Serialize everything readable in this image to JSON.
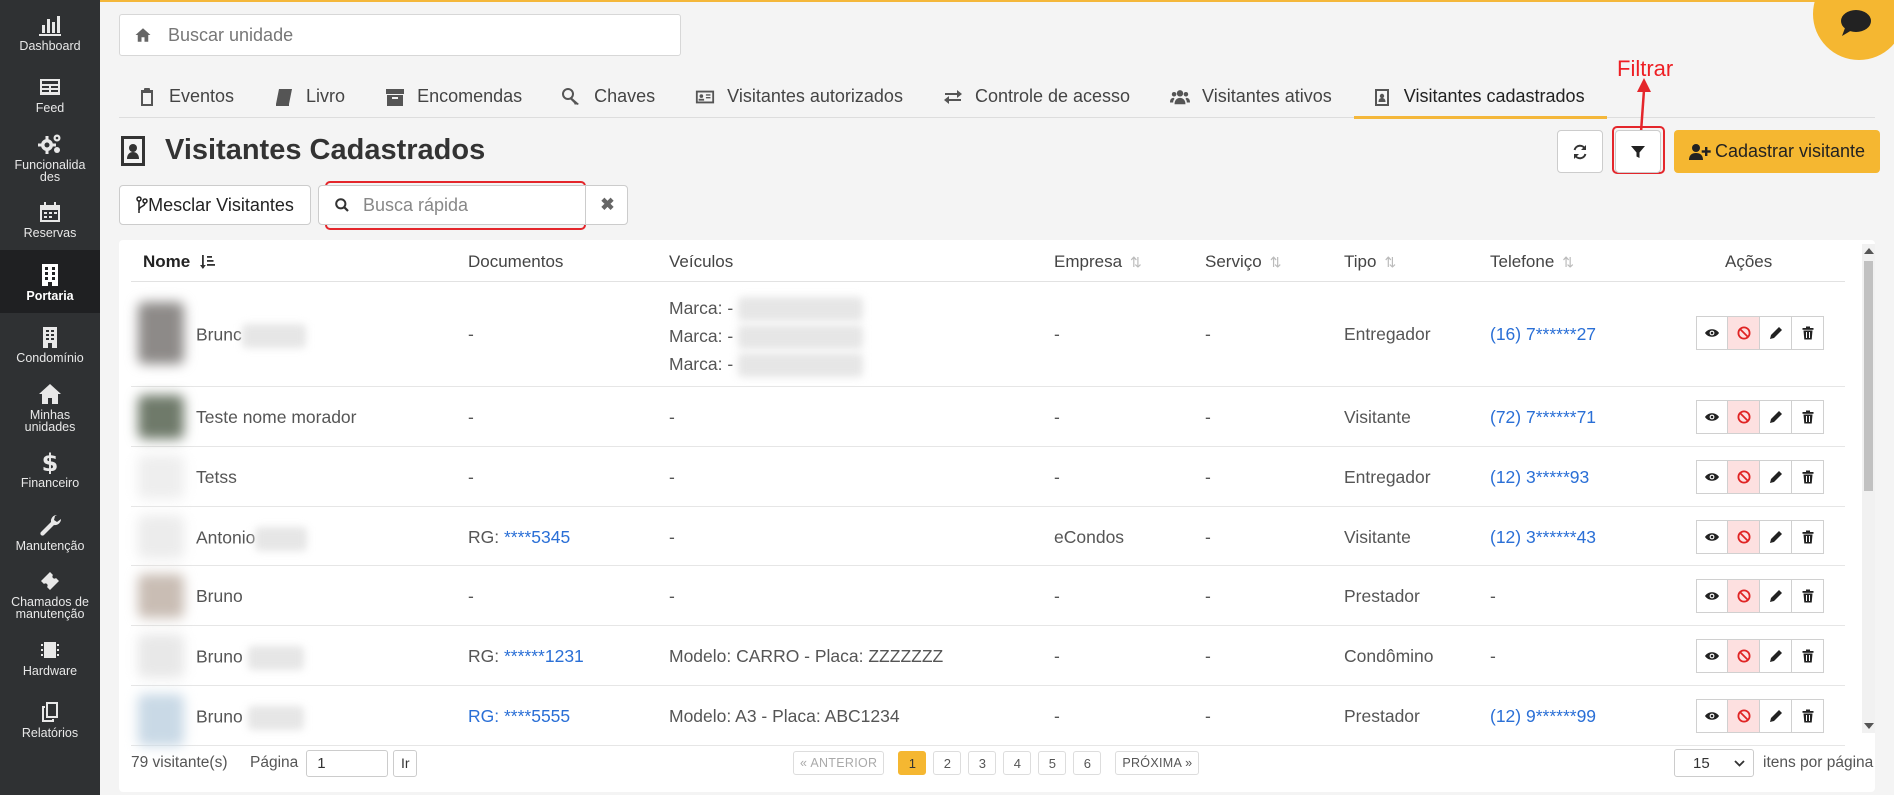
{
  "sidebar": {
    "items": [
      {
        "label": "Dashboard",
        "icon": "bar-chart-icon"
      },
      {
        "label": "Feed",
        "icon": "newspaper-icon"
      },
      {
        "label": "Funcionalidades",
        "icon": "gears-icon"
      },
      {
        "label": "Reservas",
        "icon": "calendar-icon"
      },
      {
        "label": "Portaria",
        "icon": "building-icon",
        "active": true
      },
      {
        "label": "Condomínio",
        "icon": "building-alt-icon"
      },
      {
        "label": "Minhas unidades",
        "icon": "home-icon"
      },
      {
        "label": "Financeiro",
        "icon": "dollar-icon"
      },
      {
        "label": "Manutenção",
        "icon": "wrench-icon"
      },
      {
        "label": "Chamados de manutenção",
        "icon": "ticket-icon"
      },
      {
        "label": "Hardware",
        "icon": "chip-icon"
      },
      {
        "label": "Relatórios",
        "icon": "copy-icon"
      }
    ]
  },
  "unit_search": {
    "placeholder": "Buscar unidade"
  },
  "tabs": [
    {
      "label": "Eventos",
      "icon": "clipboard-icon"
    },
    {
      "label": "Livro",
      "icon": "book-icon"
    },
    {
      "label": "Encomendas",
      "icon": "archive-icon"
    },
    {
      "label": "Chaves",
      "icon": "key-icon"
    },
    {
      "label": "Visitantes autorizados",
      "icon": "id-card-icon"
    },
    {
      "label": "Controle de acesso",
      "icon": "exchange-icon"
    },
    {
      "label": "Visitantes ativos",
      "icon": "users-icon"
    },
    {
      "label": "Visitantes cadastrados",
      "icon": "contact-book-icon",
      "active": true
    }
  ],
  "annotation": {
    "label": "Filtrar"
  },
  "page": {
    "title": "Visitantes Cadastrados"
  },
  "toolbar": {
    "add_label": "Cadastrar visitante",
    "merge_label": "Mesclar Visitantes",
    "quick_search_placeholder": "Busca rápida"
  },
  "table": {
    "columns": {
      "nome": "Nome",
      "documentos": "Documentos",
      "veiculos": "Veículos",
      "empresa": "Empresa",
      "servico": "Serviço",
      "tipo": "Tipo",
      "telefone": "Telefone",
      "acoes": "Ações"
    },
    "rows": [
      {
        "nome": "Brunc",
        "documento": "-",
        "veiculos": [
          "Marca: -",
          "Marca: -",
          "Marca: -"
        ],
        "empresa": "-",
        "servico": "-",
        "tipo": "Entregador",
        "telefone": "(16) 7******27"
      },
      {
        "nome": "Teste nome morador",
        "documento": "-",
        "veiculos": [
          "-"
        ],
        "empresa": "-",
        "servico": "-",
        "tipo": "Visitante",
        "telefone": "(72) 7******71"
      },
      {
        "nome": "Tetss",
        "documento": "-",
        "veiculos": [
          "-"
        ],
        "empresa": "-",
        "servico": "-",
        "tipo": "Entregador",
        "telefone": "(12) 3*****93"
      },
      {
        "nome": "Antonio",
        "documento_label": "RG:",
        "documento_value": "****5345",
        "veiculos": [
          "-"
        ],
        "empresa": "eCondos",
        "servico": "-",
        "tipo": "Visitante",
        "telefone": "(12) 3******43"
      },
      {
        "nome": "Bruno",
        "documento": "-",
        "veiculos": [
          "-"
        ],
        "empresa": "-",
        "servico": "-",
        "tipo": "Prestador",
        "telefone": "-"
      },
      {
        "nome": "Bruno",
        "documento_label": "RG:",
        "documento_value": "******1231",
        "veiculos": [
          "Modelo: CARRO - Placa: ZZZZZZZ"
        ],
        "empresa": "-",
        "servico": "-",
        "tipo": "Condômino",
        "telefone": "-"
      },
      {
        "nome": "Bruno",
        "documento_full_link": "RG: ****5555",
        "veiculos": [
          "Modelo: A3 - Placa: ABC1234"
        ],
        "empresa": "-",
        "servico": "-",
        "tipo": "Prestador",
        "telefone": "(12) 9******99"
      }
    ]
  },
  "footer": {
    "count": "79 visitante(s)",
    "page_label": "Página",
    "page_value": "1",
    "go_label": "Ir",
    "prev": "« ANTERIOR",
    "pages": [
      "1",
      "2",
      "3",
      "4",
      "5",
      "6"
    ],
    "current_page": "1",
    "next": "PRÓXIMA »",
    "per_page_value": "15",
    "per_page_label": "itens por página"
  },
  "colors": {
    "accent": "#f5b731",
    "sidebar": "#2f3133",
    "link": "#2a6fd6",
    "annotation": "#ee1f24"
  }
}
